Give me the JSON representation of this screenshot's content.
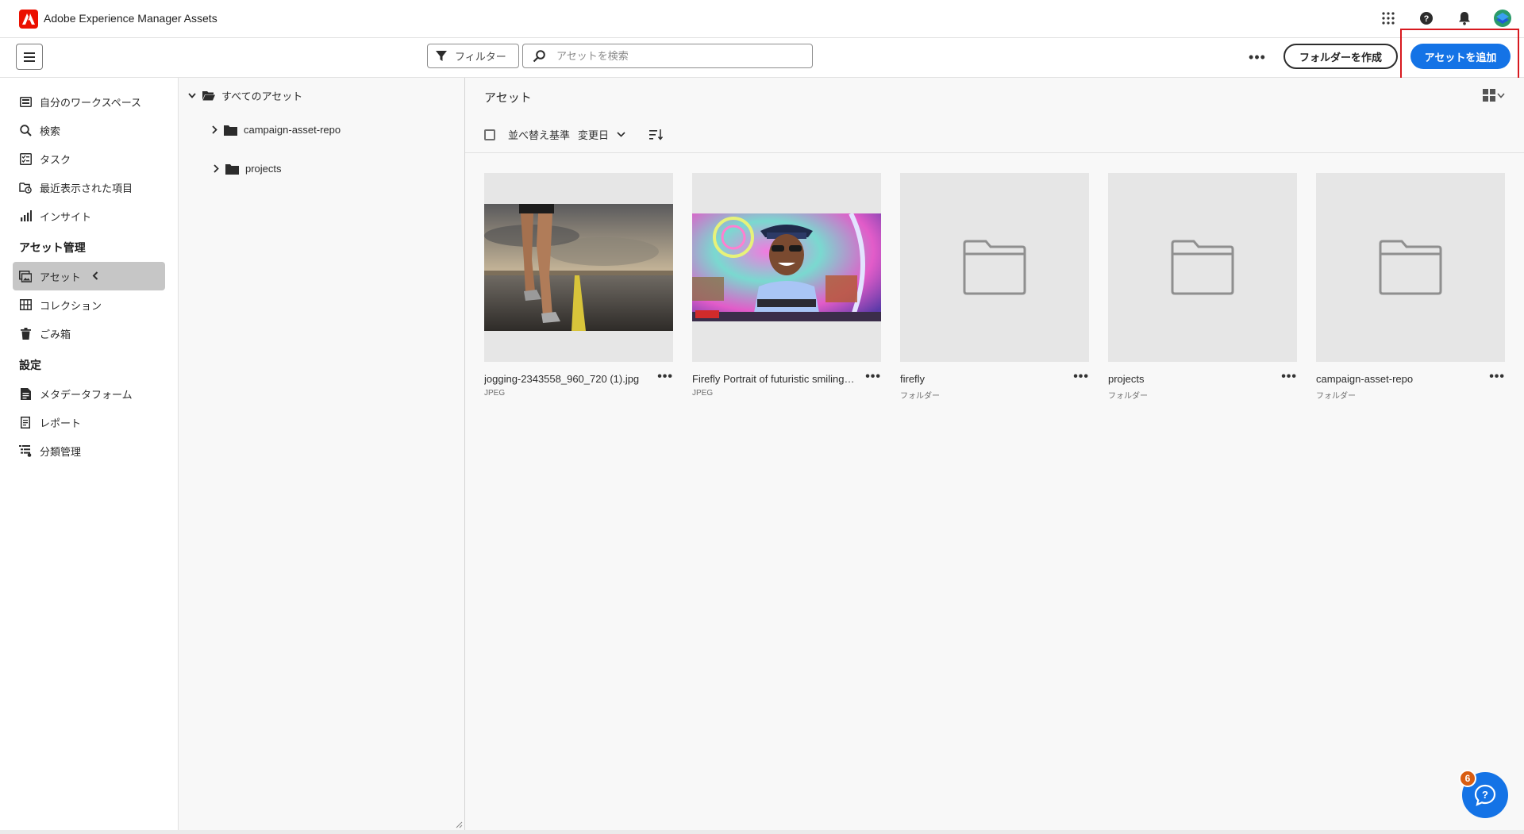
{
  "app": {
    "title": "Adobe Experience Manager Assets"
  },
  "actionbar": {
    "filter_label": "フィルター",
    "search_placeholder": "アセットを検索",
    "more_label": "•••",
    "create_folder_label": "フォルダーを作成",
    "add_asset_label": "アセットを追加"
  },
  "leftnav": {
    "items_top": [
      {
        "label": "自分のワークスペース",
        "icon": "workspace-icon"
      },
      {
        "label": "検索",
        "icon": "search-icon"
      },
      {
        "label": "タスク",
        "icon": "task-icon"
      },
      {
        "label": "最近表示された項目",
        "icon": "recent-icon"
      },
      {
        "label": "インサイト",
        "icon": "insights-icon"
      }
    ],
    "section_assets": "アセット管理",
    "items_assets": [
      {
        "label": "アセット",
        "icon": "assets-icon",
        "active": true
      },
      {
        "label": "コレクション",
        "icon": "collection-icon"
      },
      {
        "label": "ごみ箱",
        "icon": "trash-icon"
      }
    ],
    "section_settings": "設定",
    "items_settings": [
      {
        "label": "メタデータフォーム",
        "icon": "metadata-form-icon"
      },
      {
        "label": "レポート",
        "icon": "report-icon"
      },
      {
        "label": "分類管理",
        "icon": "taxonomy-icon"
      }
    ]
  },
  "tree": {
    "root": "すべてのアセット",
    "children": [
      "campaign-asset-repo",
      "projects"
    ]
  },
  "main": {
    "title": "アセット",
    "sort_label": "並べ替え基準",
    "sort_value": "変更日"
  },
  "cards": [
    {
      "name": "jogging-2343558_960_720 (1).jpg",
      "type": "JPEG"
    },
    {
      "name": "Firefly Portrait of futuristic smiling man",
      "type": "JPEG"
    },
    {
      "name": "firefly",
      "type": "フォルダー"
    },
    {
      "name": "projects",
      "type": "フォルダー"
    },
    {
      "name": "campaign-asset-repo",
      "type": "フォルダー"
    }
  ],
  "help": {
    "badge_count": "6"
  },
  "colors": {
    "accent": "#1473e6",
    "brand": "#eb1000",
    "highlight": "#d7191f",
    "badge": "#d95d11"
  }
}
